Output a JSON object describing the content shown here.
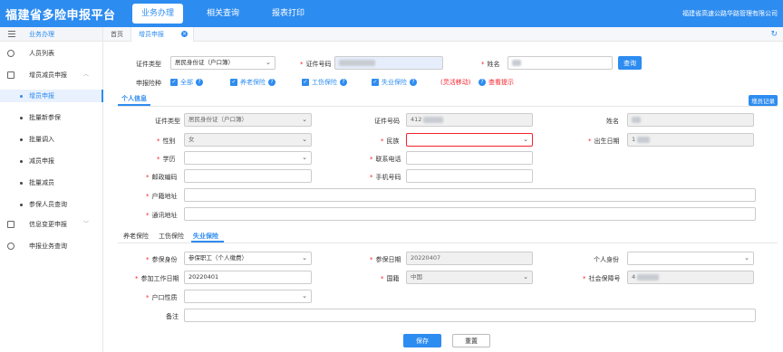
{
  "app": {
    "title": "福建省多险申报平台",
    "company": "福建省高速公路华路管理有限公司"
  },
  "top_menu": [
    {
      "label": "业务办理",
      "active": true
    },
    {
      "label": "相关查询",
      "active": false
    },
    {
      "label": "报表打印",
      "active": false
    }
  ],
  "sidebar": {
    "header": "业务办理",
    "items": {
      "staff_list": "人员列表",
      "add_reduce": "增员减员申报",
      "add_declare": "增员申报",
      "batch_new": "批量新参保",
      "batch_transfer": "批量调入",
      "reduce_declare": "减员申报",
      "batch_reduce": "批量减员",
      "insured_query": "参保人员查询",
      "info_change": "信息变更申报",
      "declare_progress": "申报业务查询"
    }
  },
  "tabs": {
    "home": "首页",
    "active": "增员申报"
  },
  "query": {
    "cert_type_label": "证件类型",
    "cert_type_value": "居民身份证（户口簿）",
    "cert_no_label": "证件号码",
    "name_label": "姓名",
    "query_button": "查询",
    "insurance_label": "申报险种",
    "checks": [
      "全部",
      "养老保险",
      "工伤保险",
      "失业保险"
    ],
    "tip1": "(灵活移动)",
    "tip2": "查看提示"
  },
  "personal": {
    "section": "个人信息",
    "record_button": "增员记录",
    "cert_type_label": "证件类型",
    "cert_type_value": "居民身份证（户口簿）",
    "cert_no_label": "证件号码",
    "cert_no_value": "412",
    "name_label": "姓名",
    "gender_label": "性别",
    "gender_value": "女",
    "ethnic_label": "民族",
    "birth_label": "出生日期",
    "birth_value": "1",
    "education_label": "学历",
    "phone_label": "联系电话",
    "postcode_label": "邮政编码",
    "mobile_label": "手机号码",
    "hukou_addr_label": "户籍地址",
    "mail_addr_label": "通讯地址"
  },
  "insurance_tabs": [
    "养老保险",
    "工伤保险",
    "失业保险"
  ],
  "unemployment": {
    "identity_label": "参保身份",
    "identity_value": "参保职工（个人缴费）",
    "date_label": "参保日期",
    "date_value": "20220407",
    "personal_identity_label": "个人身份",
    "work_date_label": "参加工作日期",
    "work_date_value": "20220401",
    "nationality_label": "国籍",
    "nationality_value": "中国",
    "ssn_label": "社会保障号",
    "ssn_value": "4",
    "hukou_nature_label": "户口性质",
    "remark_label": "备注"
  },
  "footer": {
    "save": "保存",
    "reset": "重置"
  }
}
